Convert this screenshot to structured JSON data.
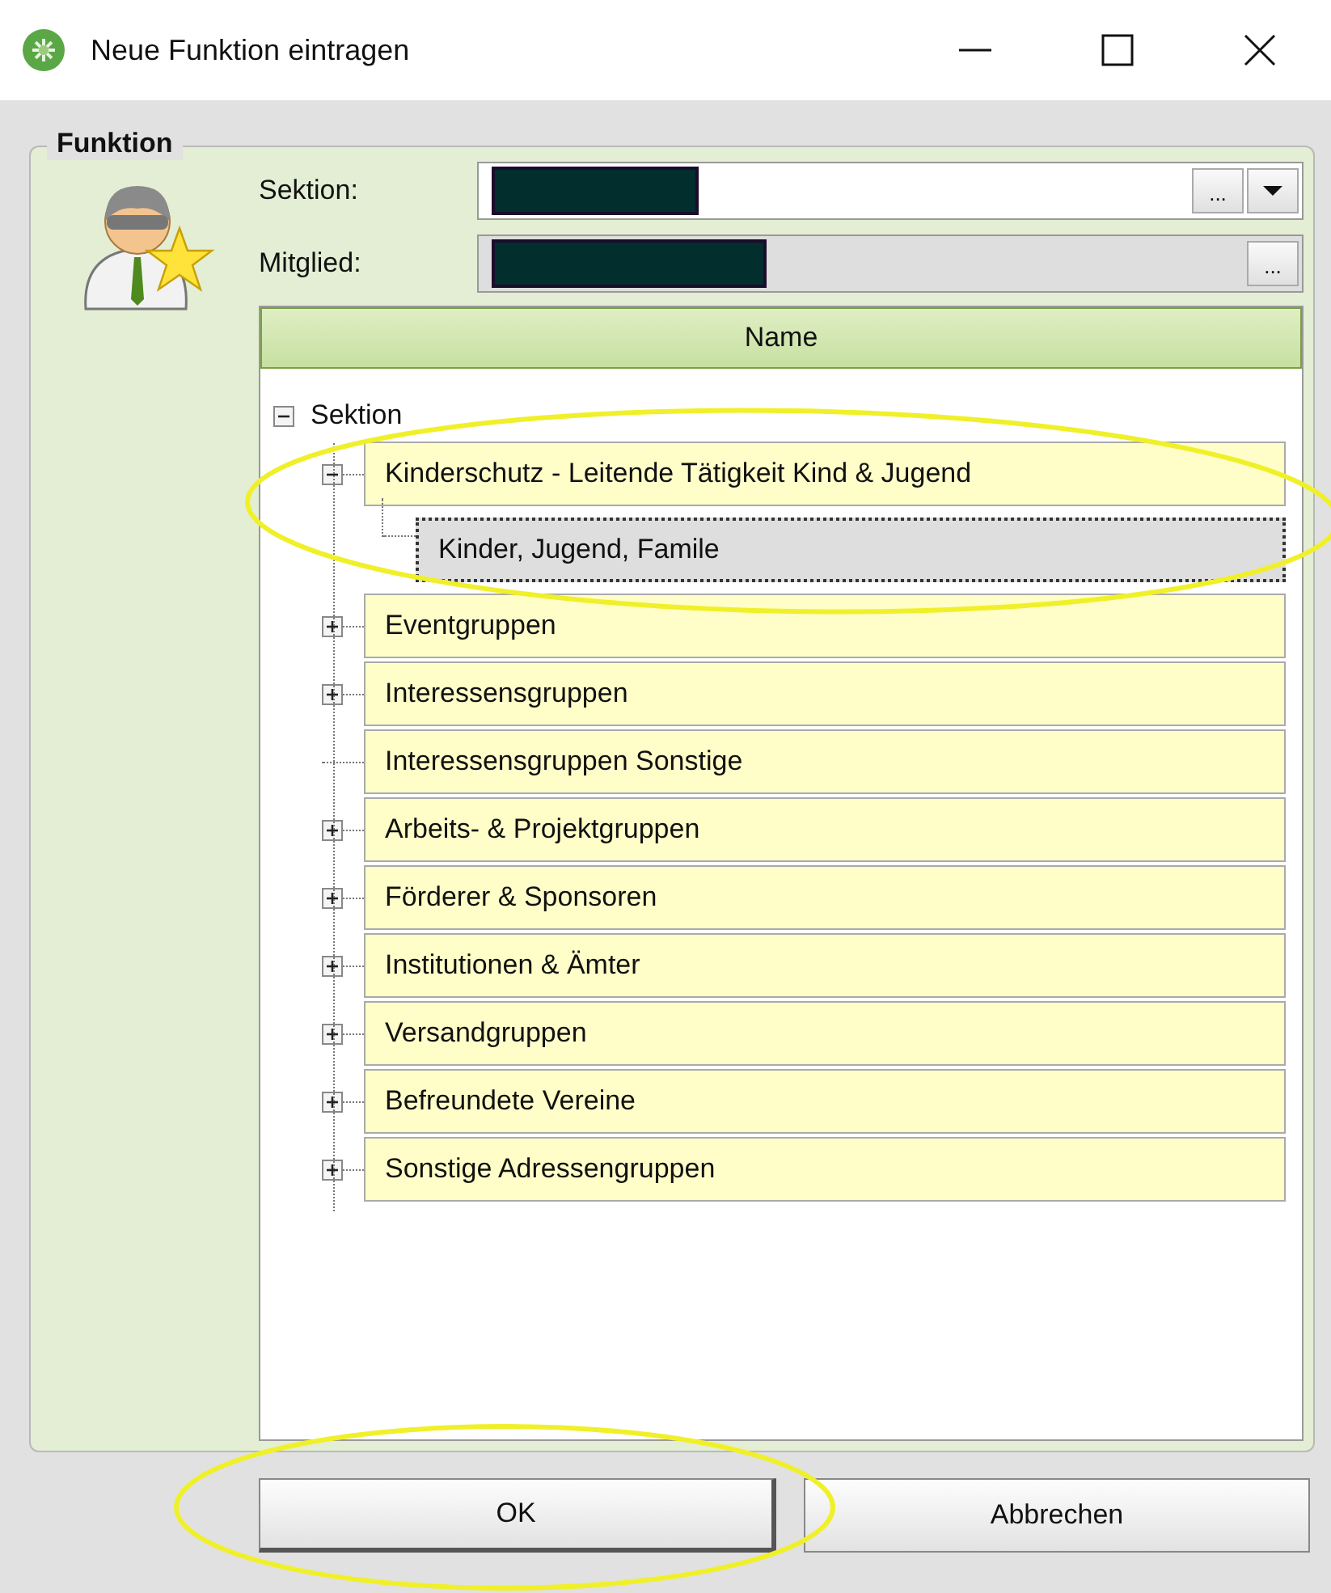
{
  "window": {
    "title": "Neue Funktion eintragen"
  },
  "group": {
    "title": "Funktion"
  },
  "fields": [
    {
      "label": "Sektion:",
      "redacted": true,
      "kind": "combo",
      "browse": "..."
    },
    {
      "label": "Mitglied:",
      "redacted": true,
      "kind": "browse",
      "browse": "..."
    }
  ],
  "table": {
    "columns": [
      "Name"
    ],
    "tree": {
      "label": "Sektion",
      "expanded": true,
      "children": [
        {
          "label": "Kinderschutz - Leitende Tätigkeit Kind & Jugend",
          "expanded": true,
          "selected": false,
          "children": [
            {
              "label": "Kinder, Jugend, Famile",
              "selected": true
            }
          ]
        },
        {
          "label": "Eventgruppen",
          "expanded": false,
          "selected": false
        },
        {
          "label": "Interessensgruppen",
          "expanded": false,
          "selected": false
        },
        {
          "label": "Interessensgruppen Sonstige",
          "selected": false
        },
        {
          "label": "Arbeits- & Projektgruppen",
          "expanded": false,
          "selected": false
        },
        {
          "label": "Förderer & Sponsoren",
          "expanded": false,
          "selected": false
        },
        {
          "label": "Institutionen & Ämter",
          "expanded": false,
          "selected": false
        },
        {
          "label": "Versandgruppen",
          "expanded": false,
          "selected": false
        },
        {
          "label": "Befreundete Vereine",
          "expanded": false,
          "selected": false
        },
        {
          "label": "Sonstige Adressengruppen",
          "expanded": false,
          "selected": false
        }
      ]
    }
  },
  "buttons": [
    {
      "label": "OK",
      "highlighted": true
    },
    {
      "label": "Abbrechen",
      "highlighted": false
    }
  ]
}
